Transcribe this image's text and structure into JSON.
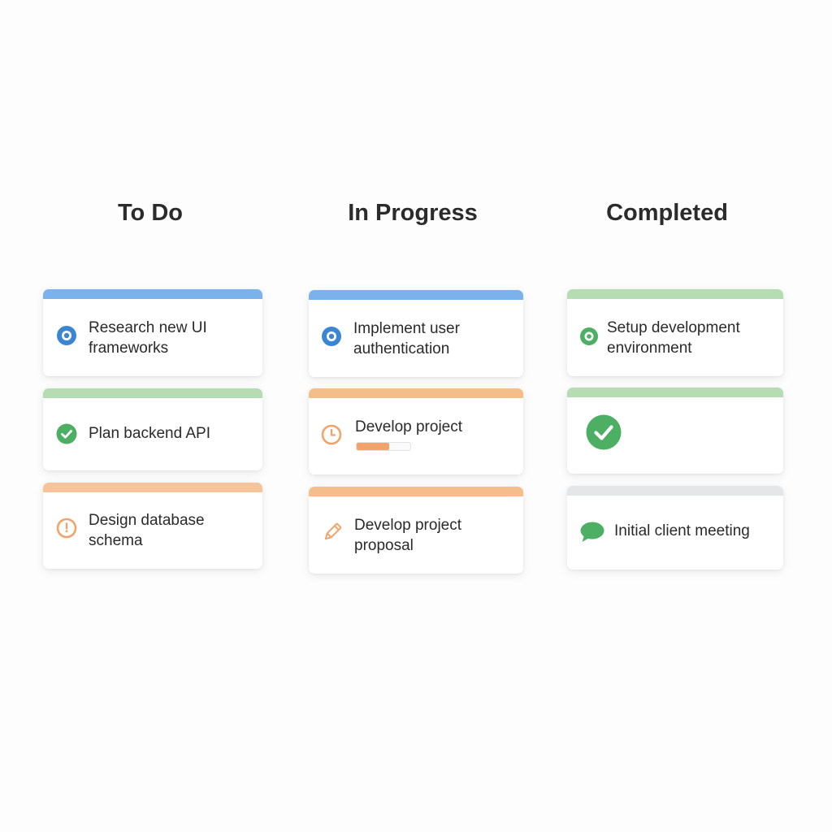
{
  "columns": [
    {
      "title": "To Do",
      "cards": [
        {
          "label_lines": [
            "Research new UI",
            "frameworks"
          ],
          "accent": "#7cb2ec",
          "icon": "target-icon"
        },
        {
          "label_lines": [
            "Plan backend API"
          ],
          "accent": "#b6dcb4",
          "icon": "check-circle-icon"
        },
        {
          "label_lines": [
            "Design database",
            "schema"
          ],
          "accent": "#f5c49b",
          "icon": "clock-icon"
        }
      ]
    },
    {
      "title": "In Progress",
      "cards": [
        {
          "label_lines": [
            "Implement user",
            "authentication"
          ],
          "accent": "#7cb2ec",
          "icon": "target-icon"
        },
        {
          "label_lines": [
            "Develop project"
          ],
          "accent": "#f5bd8a",
          "icon": "clock-icon",
          "progress": 0.6
        },
        {
          "label_lines": [
            "Develop project",
            "proposal"
          ],
          "accent": "#f5bd8a",
          "icon": "pencil-icon"
        }
      ]
    },
    {
      "title": "Completed",
      "cards": [
        {
          "label_lines": [
            "Setup development",
            "environment"
          ],
          "accent": "#b6dcb4",
          "icon": "target-small-icon"
        },
        {
          "label_lines": [],
          "accent": "#b6dcb4",
          "icon": "check-circle-large-icon"
        },
        {
          "label_lines": [
            "Initial client meeting"
          ],
          "accent": "#e4e6e8",
          "icon": "chat-bubble-icon"
        }
      ]
    }
  ],
  "colors": {
    "blue": "#3a86d3",
    "green": "#4caf63",
    "orange": "#f0a46c"
  }
}
